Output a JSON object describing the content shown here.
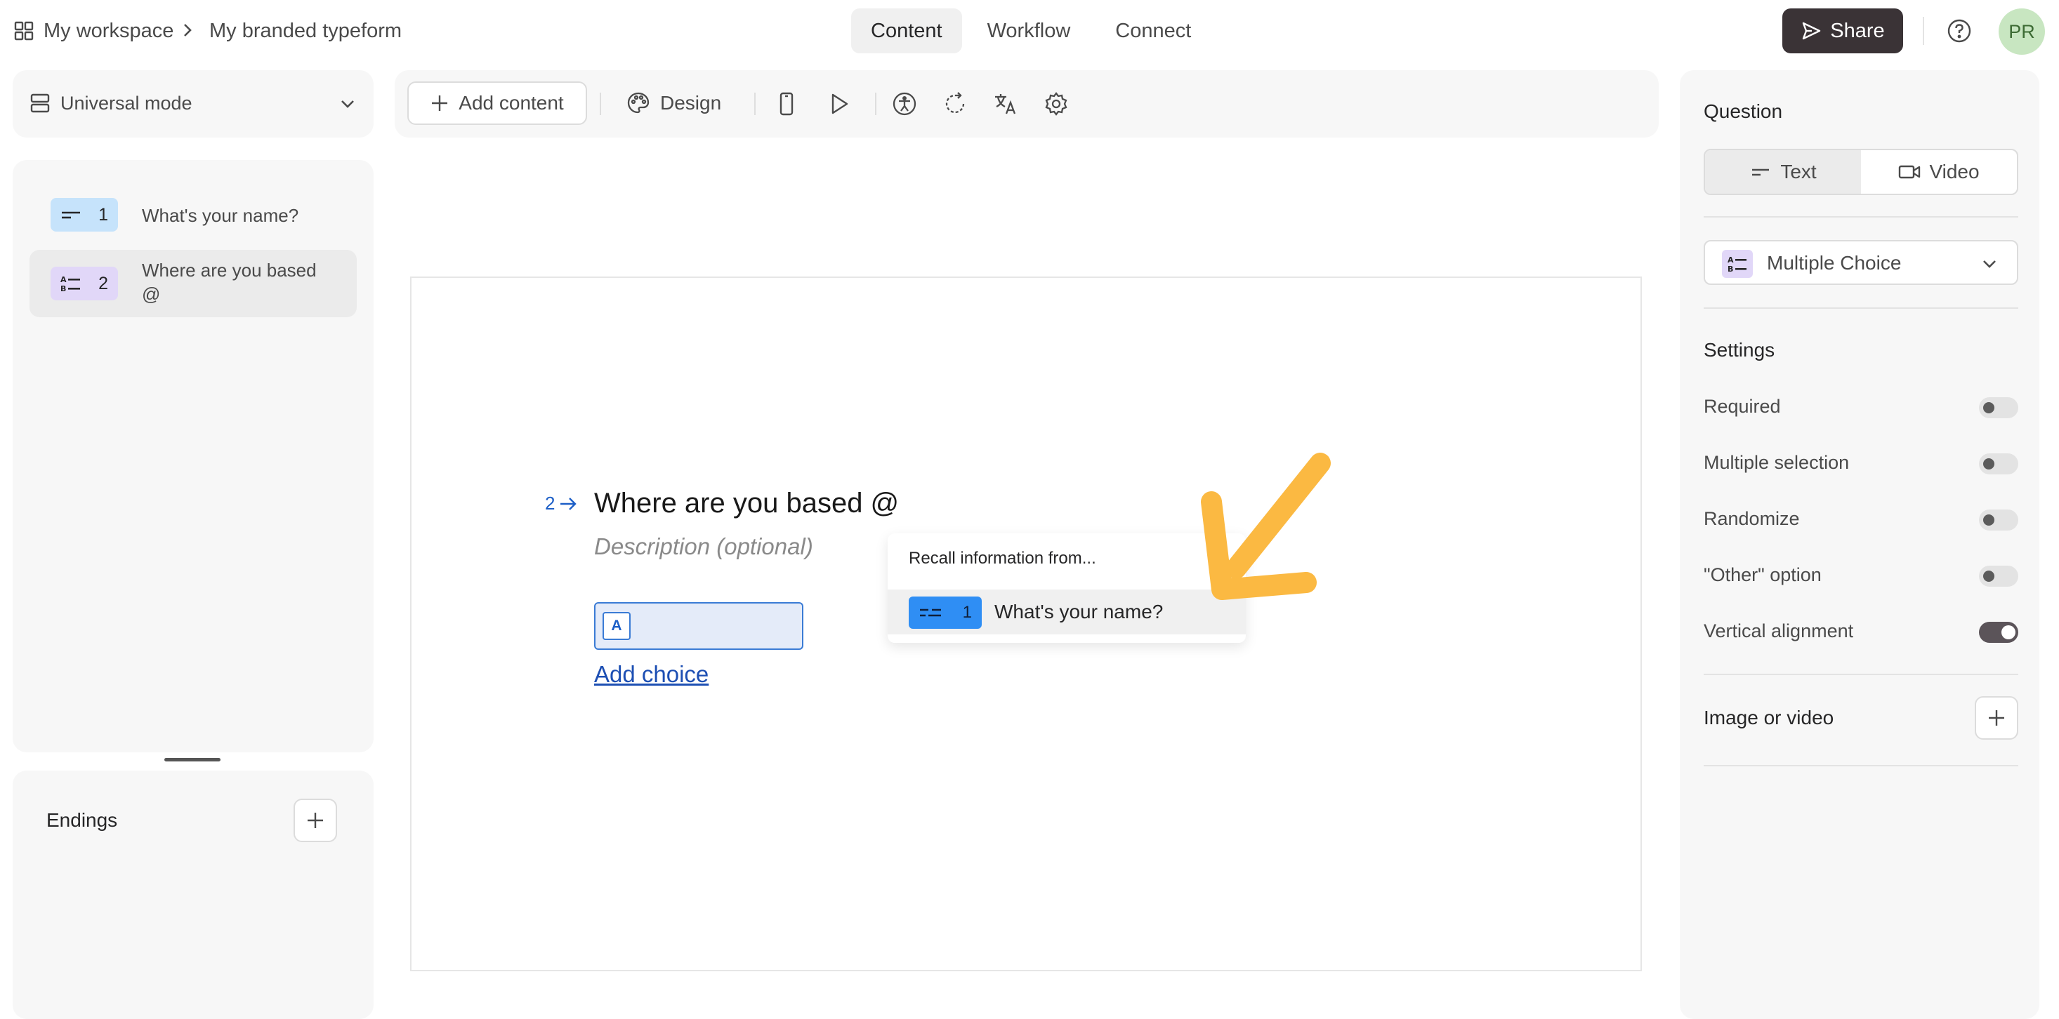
{
  "breadcrumb": {
    "workspace": "My workspace",
    "form_name": "My branded typeform"
  },
  "nav_tabs": [
    {
      "label": "Content",
      "active": true
    },
    {
      "label": "Workflow",
      "active": false
    },
    {
      "label": "Connect",
      "active": false
    }
  ],
  "header": {
    "share_label": "Share",
    "avatar_initials": "PR"
  },
  "mode": {
    "label": "Universal mode"
  },
  "questions": [
    {
      "number": "1",
      "title": "What's your name?",
      "type": "short-text"
    },
    {
      "number": "2",
      "title": "Where are you based\n@",
      "type": "multiple-choice"
    }
  ],
  "endings": {
    "title": "Endings"
  },
  "toolbar": {
    "add_content_label": "Add content",
    "design_label": "Design"
  },
  "canvas": {
    "question_number": "2",
    "question_title": "Where are you based @",
    "description_placeholder": "Description (optional)",
    "choice_key": "A",
    "add_choice_label": "Add choice"
  },
  "recall": {
    "title": "Recall information from...",
    "item_number": "1",
    "item_label": "What's your name?"
  },
  "right_panel": {
    "question_title": "Question",
    "text_tab": "Text",
    "video_tab": "Video",
    "question_type": "Multiple Choice",
    "settings_title": "Settings",
    "settings": [
      {
        "label": "Required",
        "on": false
      },
      {
        "label": "Multiple selection",
        "on": false
      },
      {
        "label": "Randomize",
        "on": false
      },
      {
        "label": "\"Other\" option",
        "on": false
      },
      {
        "label": "Vertical alignment",
        "on": true
      }
    ],
    "image_video_label": "Image or video"
  },
  "colors": {
    "accent": "#3a7bd5",
    "share_bg": "#3a3336",
    "annotation_arrow": "#fbb942",
    "short_text_badge": "#c6e3fb",
    "multiple_choice_badge": "#e1d7f8"
  }
}
